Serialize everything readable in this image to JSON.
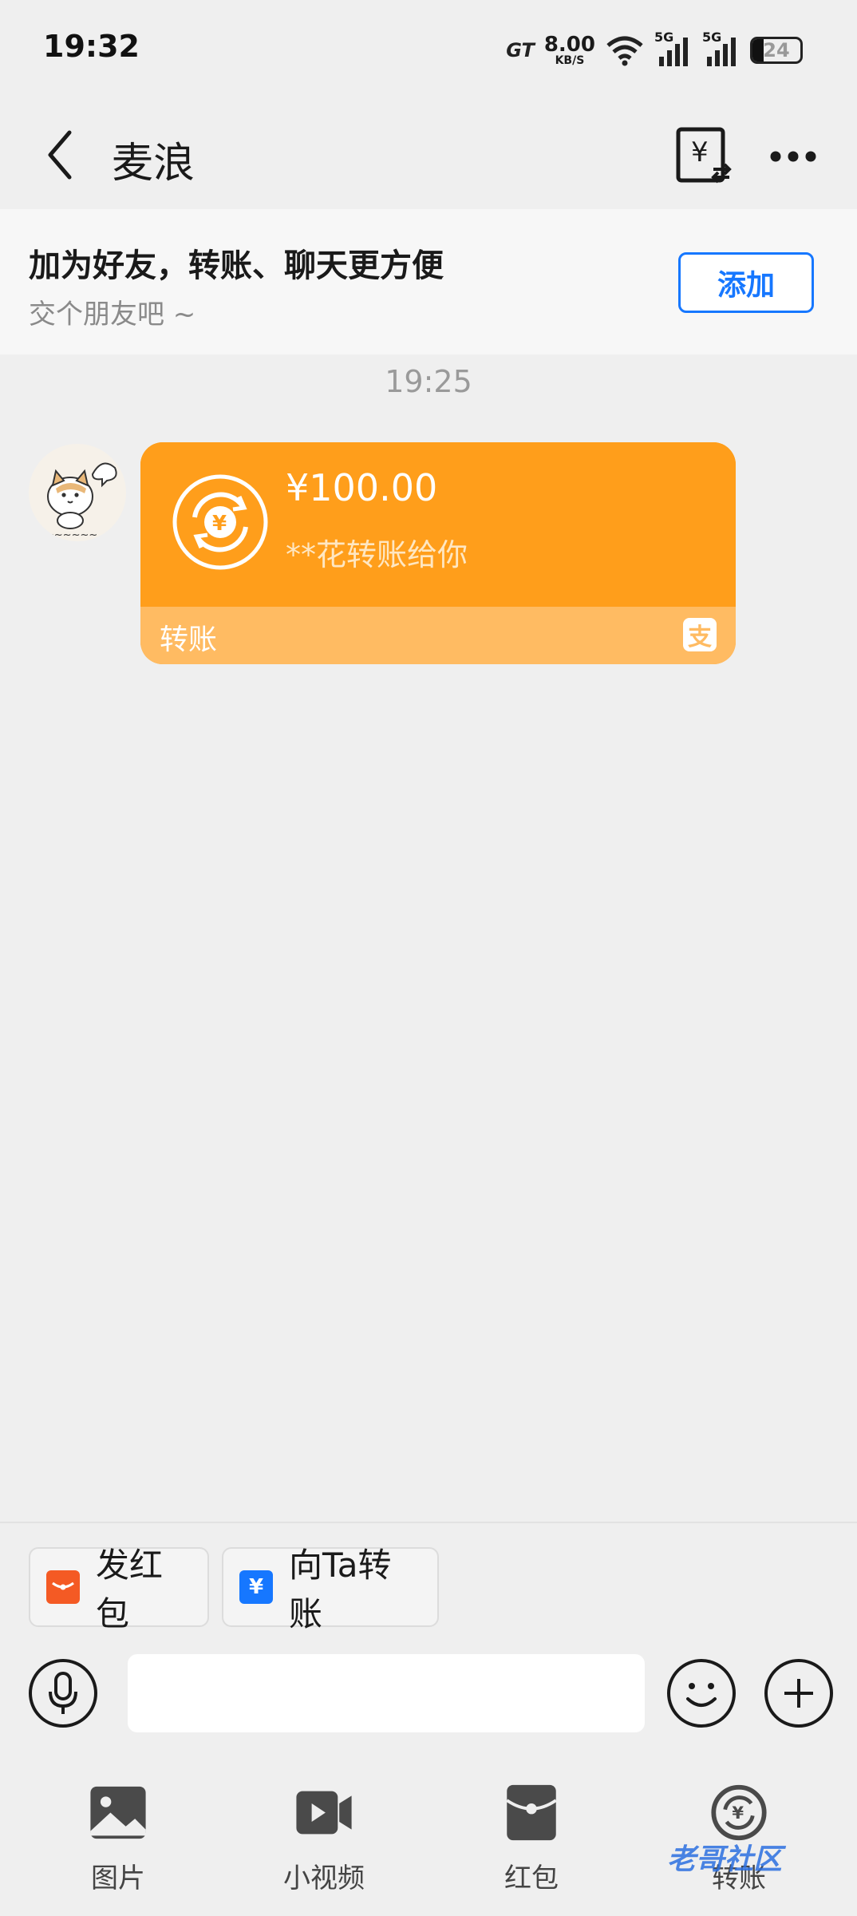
{
  "status": {
    "time": "19:32",
    "carrier_badge": "GT",
    "net_speed": "8.00",
    "net_speed_unit": "KB/S",
    "signal1_label": "5G",
    "signal2_label": "5G",
    "battery_level": "24"
  },
  "nav": {
    "title": "麦浪"
  },
  "banner": {
    "title": "加为好友，转账、聊天更方便",
    "subtitle": "交个朋友吧 ~",
    "add_label": "添加"
  },
  "chat": {
    "timestamp": "19:25",
    "transfer": {
      "amount": "¥100.00",
      "description": "**花转账给你",
      "label": "转账",
      "brand_glyph": "支"
    }
  },
  "input": {
    "quick_actions": [
      {
        "label": "发红包",
        "icon": "red-envelope-icon",
        "color": "#f45a24"
      },
      {
        "label": "向Ta转账",
        "icon": "transfer-icon",
        "color": "#1677ff"
      }
    ],
    "placeholder": ""
  },
  "toolbar": {
    "items": [
      {
        "label": "图片",
        "icon": "image-icon"
      },
      {
        "label": "小视频",
        "icon": "video-icon"
      },
      {
        "label": "红包",
        "icon": "red-envelope-icon"
      },
      {
        "label": "转账",
        "icon": "transfer-icon"
      }
    ]
  },
  "watermark": "老哥社区",
  "colors": {
    "accent_blue": "#1677ff",
    "transfer_orange": "#ff9e1b",
    "transfer_bottom": "#ffbb62"
  }
}
